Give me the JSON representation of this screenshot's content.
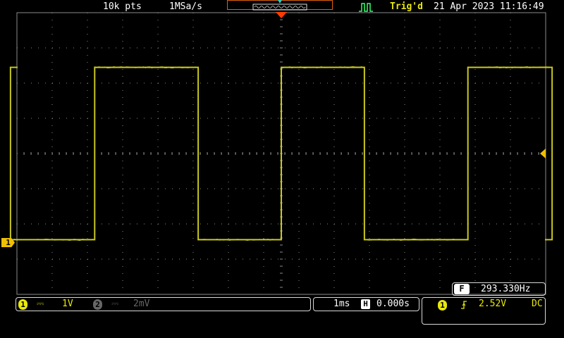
{
  "status": {
    "record_length": "10k pts",
    "sample_rate": "1MSa/s",
    "trigger_status": "Trig'd",
    "datetime": "21 Apr 2023 11:16:49"
  },
  "channel1": {
    "label": "1",
    "coupling_symbol": "⎓",
    "volts_per_div": "1V",
    "color": "#e8e80a"
  },
  "channel2": {
    "label": "2",
    "coupling_symbol": "⎓",
    "volts_per_div": "2mV",
    "color": "#666666"
  },
  "timebase": {
    "time_per_div": "1ms",
    "position_icon": "H",
    "position": "0.000s"
  },
  "trigger": {
    "source": "1",
    "slope_icon": "rising-edge-icon",
    "slope_symbol": "⨍",
    "level": "2.52V",
    "coupling": "DC"
  },
  "measurement": {
    "icon": "F",
    "frequency": "293.330Hz"
  },
  "colors": {
    "trace": "#c8c81e",
    "grid": "#8a8a8a",
    "trigger_marker": "#ff3c00",
    "trigger_level_marker": "#f0c000",
    "trig_status": "#33ff66"
  },
  "waveform": {
    "type": "square",
    "high_level_divs": 2.4,
    "low_level_divs": -2.4,
    "edges_divs": [
      -7.43,
      -5.12,
      -2.28,
      0.0,
      2.28,
      5.12,
      7.43
    ],
    "start_state": "high"
  }
}
